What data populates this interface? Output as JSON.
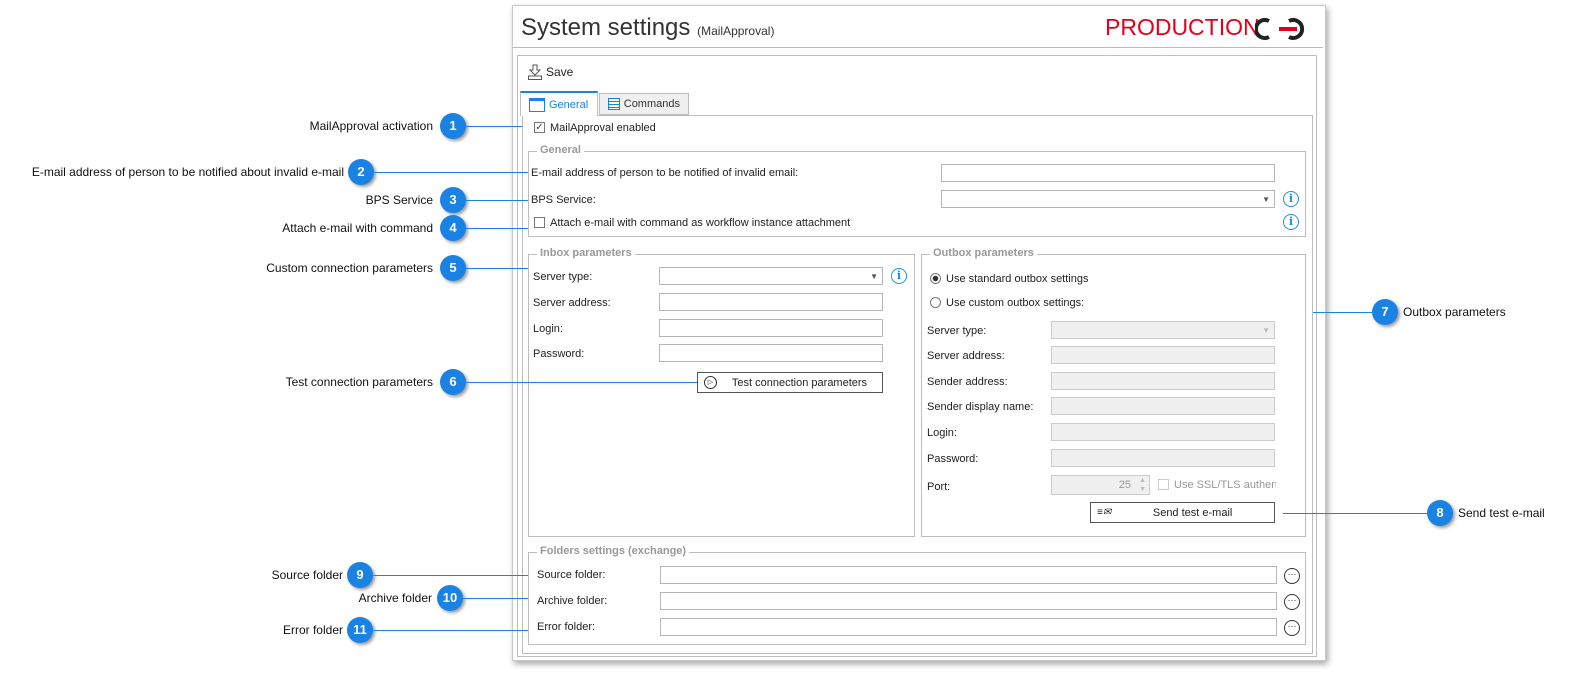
{
  "window": {
    "title": "System settings",
    "subtitle": "(MailApproval)",
    "environment": "PRODUCTION",
    "accent": "#e2001a"
  },
  "toolbar": {
    "save_label": "Save"
  },
  "tabs": [
    {
      "label": "General",
      "active": true
    },
    {
      "label": "Commands",
      "active": false
    }
  ],
  "activation": {
    "label": "MailApproval enabled",
    "checked": true
  },
  "general": {
    "legend": "General",
    "email_label": "E-mail address of person to be notified of invalid email:",
    "email_value": "",
    "bps_label": "BPS Service:",
    "bps_value": "",
    "attach_label": "Attach e-mail with command as workflow instance attachment",
    "attach_checked": false
  },
  "inbox": {
    "legend": "Inbox parameters",
    "server_type": "Server type:",
    "server_address": "Server address:",
    "login": "Login:",
    "password": "Password:",
    "test_button": "Test connection parameters"
  },
  "outbox": {
    "legend": "Outbox parameters",
    "radio_standard": "Use standard outbox settings",
    "radio_custom": "Use custom outbox settings:",
    "selected": "standard",
    "server_type": "Server type:",
    "server_address": "Server address:",
    "sender_address": "Sender address:",
    "sender_display_name": "Sender display name:",
    "login": "Login:",
    "password": "Password:",
    "port_label": "Port:",
    "port_value": "25",
    "ssl_label": "Use SSL/TLS authenti",
    "send_button": "Send test e-mail"
  },
  "folders": {
    "legend": "Folders settings (exchange)",
    "source": "Source folder:",
    "archive": "Archive folder:",
    "error": "Error folder:"
  },
  "callouts": [
    {
      "n": "1",
      "label": "MailApproval activation"
    },
    {
      "n": "2",
      "label": "E-mail address of person to be notified about invalid e-mail"
    },
    {
      "n": "3",
      "label": "BPS Service"
    },
    {
      "n": "4",
      "label": "Attach e-mail with command"
    },
    {
      "n": "5",
      "label": "Custom connection parameters"
    },
    {
      "n": "6",
      "label": "Test connection parameters"
    },
    {
      "n": "7",
      "label": "Outbox parameters"
    },
    {
      "n": "8",
      "label": "Send test e-mail"
    },
    {
      "n": "9",
      "label": "Source folder"
    },
    {
      "n": "10",
      "label": "Archive folder"
    },
    {
      "n": "11",
      "label": "Error folder"
    }
  ],
  "callout_color": "#1a82e2"
}
